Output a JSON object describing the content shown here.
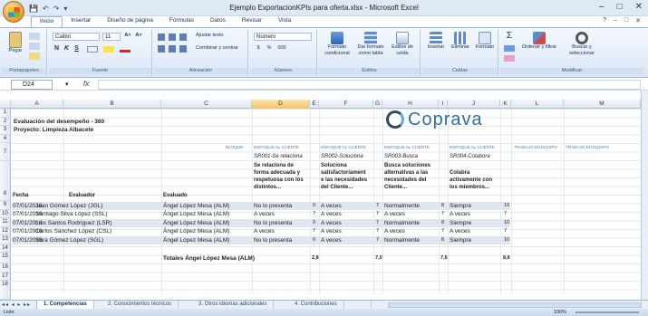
{
  "window": {
    "title": "Ejemplo ExportacionKPIs para oferta.xlsx - Microsoft Excel",
    "minimize": "–",
    "maximize": "□",
    "close": "✕"
  },
  "qat": {
    "save": "💾",
    "undo": "↶",
    "redo": "↷",
    "more": "▾"
  },
  "tabs": [
    "Inicio",
    "Insertar",
    "Diseño de página",
    "Fórmulas",
    "Datos",
    "Revisar",
    "Vista"
  ],
  "tab_right": {
    "help": "?",
    "min": "–",
    "restore": "□",
    "close": "✕"
  },
  "ribbon": {
    "clipboard": {
      "label": "Portapapeles",
      "paste": "Pegar"
    },
    "font": {
      "label": "Fuente",
      "name": "Calibri",
      "size": "11",
      "grow": "A˄",
      "shrink": "A˅",
      "bold": "N",
      "italic": "K",
      "underline": "S"
    },
    "alignment": {
      "label": "Alineación",
      "wrap": "Ajustar texto",
      "merge": "Combinar y centrar"
    },
    "number": {
      "label": "Número",
      "format": "Número",
      "currency": "$",
      "percent": "%",
      "thousands": "000"
    },
    "styles": {
      "label": "Estilos",
      "conditional": "Formato condicional",
      "table": "Dar formato como tabla",
      "cell": "Estilos de celda"
    },
    "cells": {
      "label": "Celdas",
      "insert": "Insertar",
      "delete": "Eliminar",
      "format": "Formato"
    },
    "editing": {
      "label": "Modificar",
      "sort": "Ordenar y filtrar",
      "find": "Buscar y seleccionar",
      "sum": "Σ"
    }
  },
  "formula_bar": {
    "cell_ref": "D24",
    "fx": "fx",
    "value": ""
  },
  "columns": [
    "A",
    "B",
    "C",
    "D",
    "E",
    "F",
    "G",
    "H",
    "I",
    "J",
    "K",
    "L",
    "M"
  ],
  "rows": [
    "1",
    "2",
    "3",
    "4",
    "7",
    "8",
    "9",
    "10",
    "11",
    "12",
    "13",
    "14",
    "15",
    "16",
    "17",
    "18"
  ],
  "sheet": {
    "title": "Evaluación del desempeño - 360",
    "project": "Proyecto: Limpieza Albacete",
    "logo": "Coprava",
    "bloque_label": "BLOQUE:",
    "blocks": [
      "ENFOQUE AL CLIENTE",
      "ENFOQUE AL CLIENTE",
      "ENFOQUE AL CLIENTE",
      "ENFOQUE AL CLIENTE",
      "TRABAJO EN EQUIPO",
      "TRABAJO EN EQUIPO"
    ],
    "codes": [
      "SR001-Se relaciona",
      "SR002-Soluciona",
      "SR003-Busca",
      "SR004-Colabora"
    ],
    "descriptions": [
      [
        "Se relaciona de",
        "forma adecuada y",
        "respetuosa con los",
        "distintos..."
      ],
      [
        "Soluciona",
        "satisfactoriament",
        "e las necesidades",
        "del Cliente..."
      ],
      [
        "Busca soluciones",
        "alternativas a las",
        "necesidades del",
        "Cliente..."
      ],
      [
        "Colabra",
        "activamente con",
        "los miembros..."
      ]
    ],
    "headers": {
      "fecha": "Fecha",
      "evaluador": "Evaluador",
      "evaluado": "Evaluado"
    },
    "records": [
      {
        "fecha": "07/01/2016",
        "evaluador": "Juan Gómez López (JGL)",
        "evaluado": "Ángel López Mesa (ALM)",
        "d": "No lo presenta",
        "e": "0",
        "f": "A veces",
        "g": "7",
        "h": "Normalmente",
        "i": "8",
        "j": "Siempre",
        "k": "10"
      },
      {
        "fecha": "07/01/2016",
        "evaluador": "Santiago Silva López (SSL)",
        "evaluado": "Ángel López Mesa (ALM)",
        "d": "A veces",
        "e": "7",
        "f": "A veces",
        "g": "7",
        "h": "A veces",
        "i": "7",
        "j": "A veces",
        "k": "7"
      },
      {
        "fecha": "07/01/2016",
        "evaluador": "Luis Santos Rodríguez (LSR)",
        "evaluado": "Ángel López Mesa (ALM)",
        "d": "No lo presenta",
        "e": "0",
        "f": "A veces",
        "g": "7",
        "h": "Normalmente",
        "i": "8",
        "j": "Siempre",
        "k": "10"
      },
      {
        "fecha": "07/01/2016",
        "evaluador": "Carlos Sánchez López (CSL)",
        "evaluado": "Ángel López Mesa (ALM)",
        "d": "A veces",
        "e": "7",
        "f": "A veces",
        "g": "7",
        "h": "A veces",
        "i": "7",
        "j": "A veces",
        "k": "7"
      },
      {
        "fecha": "07/01/2016",
        "evaluador": "Sara Gómez López (SGL)",
        "evaluado": "Ángel López Mesa (ALM)",
        "d": "No lo presenta",
        "e": "0",
        "f": "A veces",
        "g": "7",
        "h": "Normalmente",
        "i": "8",
        "j": "Siempre",
        "k": "10"
      }
    ],
    "totals": {
      "label": "Totales Ángel López Mesa (ALM)",
      "e": "2,8",
      "g": "7,0",
      "i": "7,6",
      "k": "8,8"
    }
  },
  "sheet_tabs": [
    "1. Competencias",
    "2. Conocimientos técnicos",
    "3. Otros idiomas adicionales",
    "4. Contribuciones"
  ],
  "status": {
    "text": "Listo",
    "zoom": "100%"
  }
}
